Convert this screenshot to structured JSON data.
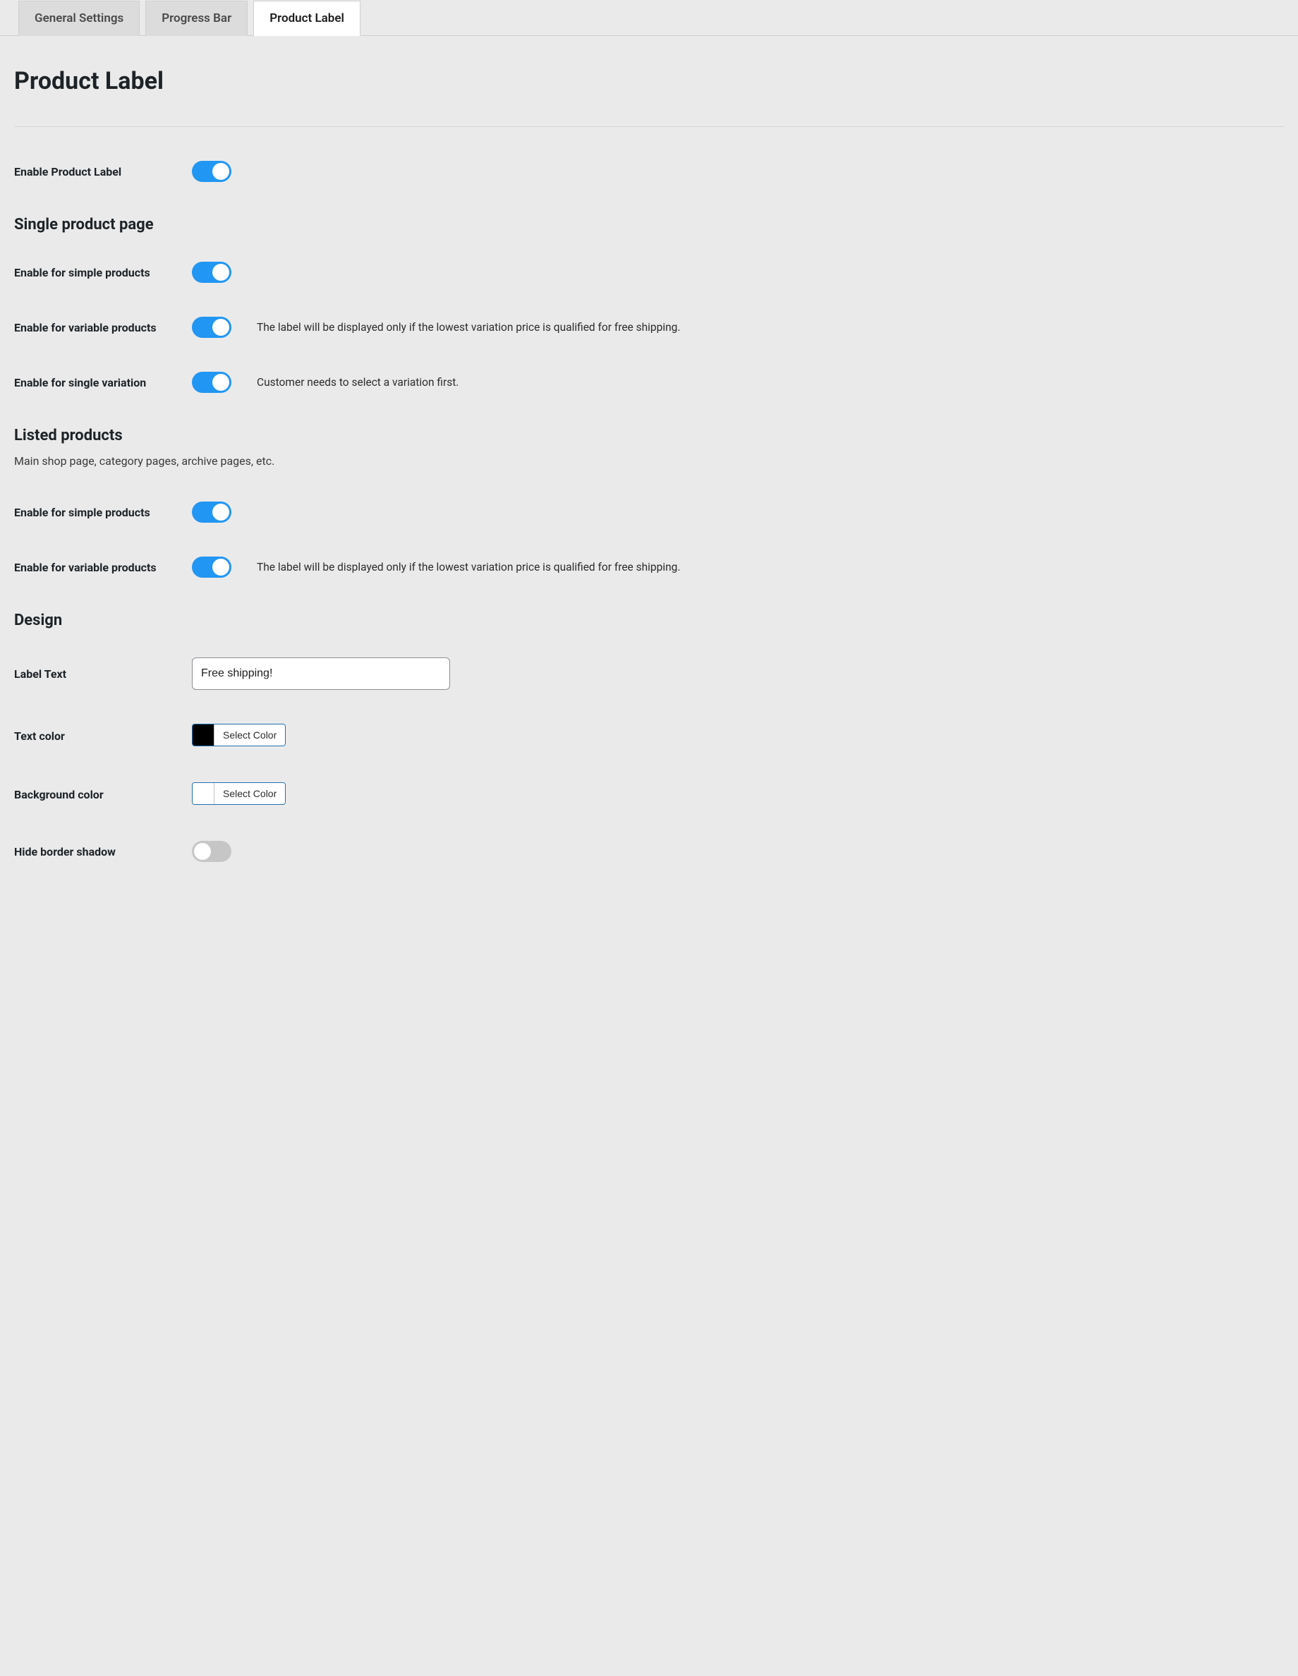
{
  "tabs": {
    "general": "General Settings",
    "progress": "Progress Bar",
    "productLabel": "Product Label"
  },
  "page": {
    "title": "Product Label"
  },
  "main": {
    "enable": {
      "label": "Enable Product Label",
      "on": true
    }
  },
  "single": {
    "heading": "Single product page",
    "simple": {
      "label": "Enable for simple products",
      "on": true
    },
    "variable": {
      "label": "Enable for variable products",
      "on": true,
      "desc": "The label will be displayed only if the lowest variation price is qualified for free shipping."
    },
    "singleVar": {
      "label": "Enable for single variation",
      "on": true,
      "desc": "Customer needs to select a variation first."
    }
  },
  "listed": {
    "heading": "Listed products",
    "sub": "Main shop page, category pages, archive pages, etc.",
    "simple": {
      "label": "Enable for simple products",
      "on": true
    },
    "variable": {
      "label": "Enable for variable products",
      "on": true,
      "desc": "The label will be displayed only if the lowest variation price is qualified for free shipping."
    }
  },
  "design": {
    "heading": "Design",
    "labelText": {
      "label": "Label Text",
      "value": "Free shipping!"
    },
    "textColor": {
      "label": "Text color",
      "swatch": "#000000",
      "button": "Select Color"
    },
    "bgColor": {
      "label": "Background color",
      "swatch": "#ffffff",
      "button": "Select Color"
    },
    "hideShadow": {
      "label": "Hide border shadow",
      "on": false
    }
  }
}
